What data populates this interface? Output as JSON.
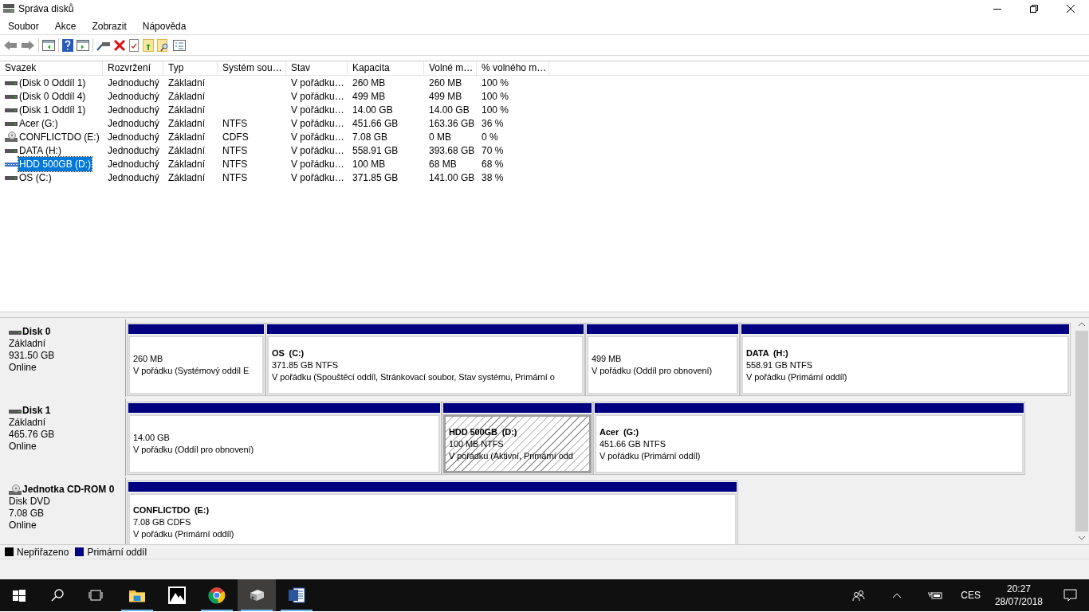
{
  "window": {
    "title": "Správa disků"
  },
  "menu": [
    "Soubor",
    "Akce",
    "Zobrazit",
    "Nápověda"
  ],
  "table": {
    "columns": [
      "Svazek",
      "Rozvržení",
      "Typ",
      "Systém sou…",
      "Stav",
      "Kapacita",
      "Volné m…",
      "% volného m…"
    ],
    "rows": [
      {
        "kind": "disk",
        "selected": false,
        "cells": [
          "(Disk 0 Oddíl 1)",
          "Jednoduchý",
          "Základní",
          "",
          "V pořádku…",
          "260 MB",
          "260 MB",
          "100 %"
        ]
      },
      {
        "kind": "disk",
        "selected": false,
        "cells": [
          "(Disk 0 Oddíl 4)",
          "Jednoduchý",
          "Základní",
          "",
          "V pořádku…",
          "499 MB",
          "499 MB",
          "100 %"
        ]
      },
      {
        "kind": "disk",
        "selected": false,
        "cells": [
          "(Disk 1 Oddíl 1)",
          "Jednoduchý",
          "Základní",
          "",
          "V pořádku…",
          "14.00 GB",
          "14.00 GB",
          "100 %"
        ]
      },
      {
        "kind": "disk",
        "selected": false,
        "cells": [
          "Acer (G:)",
          "Jednoduchý",
          "Základní",
          "NTFS",
          "V pořádku…",
          "451.66 GB",
          "163.36 GB",
          "36 %"
        ]
      },
      {
        "kind": "cd",
        "selected": false,
        "cells": [
          "CONFLICTDO (E:)",
          "Jednoduchý",
          "Základní",
          "CDFS",
          "V pořádku…",
          "7.08 GB",
          "0 MB",
          "0 %"
        ]
      },
      {
        "kind": "disk",
        "selected": false,
        "cells": [
          "DATA (H:)",
          "Jednoduchý",
          "Základní",
          "NTFS",
          "V pořádku…",
          "558.91 GB",
          "393.68 GB",
          "70 %"
        ]
      },
      {
        "kind": "disk",
        "selected": true,
        "cells": [
          "HDD 500GB (D:)",
          "Jednoduchý",
          "Základní",
          "NTFS",
          "V pořádku…",
          "100 MB",
          "68 MB",
          "68 %"
        ]
      },
      {
        "kind": "disk",
        "selected": false,
        "cells": [
          "OS (C:)",
          "Jednoduchý",
          "Základní",
          "NTFS",
          "V pořádku…",
          "371.85 GB",
          "141.00 GB",
          "38 %"
        ]
      }
    ]
  },
  "disks": [
    {
      "kind": "disk",
      "name": "Disk 0",
      "type": "Základní",
      "size": "931.50 GB",
      "status": "Online",
      "partitions": [
        {
          "selected": false,
          "size": "260 MB",
          "state": "V pořádku (Systémový oddíl E"
        },
        {
          "selected": false,
          "label": "OS  (C:)",
          "size": "371.85 GB NTFS",
          "state": "V pořádku (Spouštěcí oddíl, Stránkovací soubor, Stav systému, Primární o"
        },
        {
          "selected": false,
          "size": "499 MB",
          "state": "V pořádku (Oddíl pro obnovení)"
        },
        {
          "selected": false,
          "label": "DATA  (H:)",
          "size": "558.91 GB NTFS",
          "state": "V pořádku (Primární oddíl)"
        }
      ]
    },
    {
      "kind": "disk",
      "name": "Disk 1",
      "type": "Základní",
      "size": "465.76 GB",
      "status": "Online",
      "partitions": [
        {
          "selected": false,
          "size": "14.00 GB",
          "state": "V pořádku (Oddíl pro obnovení)"
        },
        {
          "selected": true,
          "label": "HDD 500GB  (D:)",
          "size": "100 MB NTFS",
          "state": "V pořádku (Aktivní, Primární odd"
        },
        {
          "selected": false,
          "label": "Acer  (G:)",
          "size": "451.66 GB NTFS",
          "state": "V pořádku (Primární oddíl)"
        }
      ]
    },
    {
      "kind": "cd",
      "name": "Jednotka CD-ROM 0",
      "type": "Disk DVD",
      "size": "7.08 GB",
      "status": "Online",
      "partitions": [
        {
          "selected": false,
          "label": "CONFLICTDO  (E:)",
          "size": "7.08 GB CDFS",
          "state": "V pořádku (Primární oddíl)"
        }
      ]
    }
  ],
  "legend": [
    {
      "label": "Nepřiřazeno",
      "color": "#000000"
    },
    {
      "label": "Primární oddíl",
      "color": "#000080"
    }
  ],
  "taskbar": {
    "apps": [
      {
        "kind": "explorer",
        "running": true,
        "selected": false
      },
      {
        "kind": "photos",
        "running": false,
        "selected": false
      },
      {
        "kind": "browser",
        "running": true,
        "selected": false
      },
      {
        "kind": "diskmgmt",
        "running": true,
        "selected": true
      },
      {
        "kind": "word",
        "running": true,
        "selected": false
      }
    ],
    "language": "CES",
    "time": "20:27",
    "date": "28/07/2018"
  }
}
